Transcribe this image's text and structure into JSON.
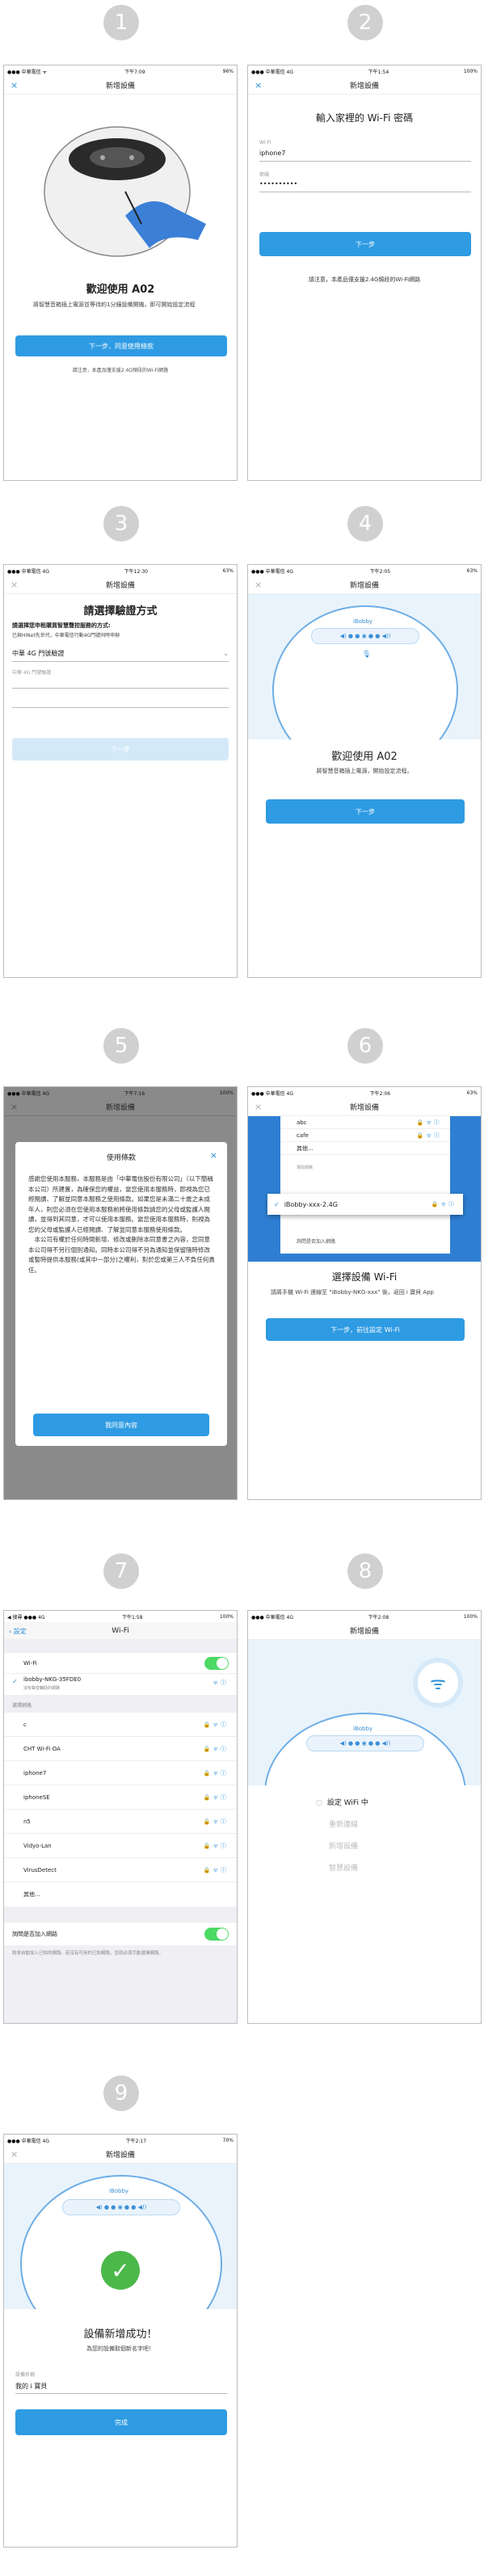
{
  "steps": [
    "1",
    "2",
    "3",
    "4",
    "5",
    "6",
    "7",
    "8",
    "9"
  ],
  "common": {
    "title": "新增設備",
    "close": "×",
    "battery": "100%",
    "carrier": "中華電信"
  },
  "p1": {
    "status": {
      "carrier": "●●● 中華電信 ᯤ",
      "time": "下午7:09",
      "battery": "96%"
    },
    "heading": "歡迎使用 A02",
    "desc": "將智慧音箱插上電源並等待約1分鐘設備開機，即可開始設定流程",
    "btn": "下一步，同意使用條款",
    "note": "請注意，本產品僅支援2.4G頻段的Wi-Fi網路"
  },
  "p2": {
    "status": {
      "carrier": "●●● 中華電信 4G",
      "time": "下午1:54",
      "battery": "100%"
    },
    "heading": "輸入家裡的 Wi-Fi 密碼",
    "wifi_label": "Wi-Fi",
    "wifi_value": "iphone7",
    "pwd_label": "密碼",
    "pwd_value": "••••••••••",
    "btn": "下一步",
    "note": "請注意，本產品僅支援2.4G頻段的Wi-Fi網路"
  },
  "p3": {
    "status": {
      "carrier": "●●● 中華電信 4G",
      "time": "下午12:30",
      "battery": "63%"
    },
    "heading": "請選擇驗證方式",
    "desc1": "請選擇您申租購買智慧聲控服務的方式:",
    "desc2": "已與HiNet先世代，中華電信行動4G門號同時申辦",
    "select": "中華 4G 門號驗證",
    "field_label": "中華 4G 門號驗證",
    "btn": "下一步"
  },
  "p4": {
    "status": {
      "carrier": "●●● 中華電信 4G",
      "time": "下午2:05",
      "battery": "63%"
    },
    "brand": "iBobby",
    "heading": "歡迎使用 A02",
    "desc": "將智慧音箱插上電源，開始設定流程。",
    "btn": "下一步"
  },
  "p5": {
    "status": {
      "carrier": "●●● 中華電信 4G",
      "time": "下午7:16",
      "battery": "100%"
    },
    "modal_title": "使用條款",
    "body": "感謝您使用本服務，本服務是由「中華電信股份有限公司」（以下簡稱本公司）所建置，為確保您的權益，當您使用本服務時，即視為您已經閱讀、了解並同意本服務之使用條款。如果您是未滿二十歲之未成年人，則您必須在您使用本服務前將使用條款請您的父母或監護人閱讀，並得到其同意，才可以使用本服務。當您使用本服務時，則視為您的父母或監護人已經閱讀、了解並同意本服務使用條款。\n　本公司有權於任何時間新增、修改或刪除本同意書之內容，您同意本公司得不另行個別通知。同時本公司得不另為通知並保留隨時修改或暫時提供本服務(或其中一部分)之權利，對於您或第三人不負任何責任。",
    "btn": "我同意內容"
  },
  "p6": {
    "status": {
      "carrier": "●●● 中華電信 4G",
      "time": "下午2:06",
      "battery": "63%"
    },
    "list": [
      "abc",
      "cafe",
      "其他..."
    ],
    "section": "選取網路",
    "selected": "iBobby-xxx-2.4G",
    "ask": "詢問是否加入網路",
    "heading": "選擇設備 Wi-Fi",
    "desc": "請將手機 Wi-Fi 連線至 \"iBobby-NKG-xxx\" 後，返回 i 寶貝 App",
    "btn": "下一步，前往設定 Wi-Fi"
  },
  "p7": {
    "status": {
      "carrier": "◀ 搜尋 ●●● 4G",
      "time": "下午1:58",
      "battery": "100%"
    },
    "back": "設定",
    "title": "Wi-Fi",
    "wifi": "Wi-Fi",
    "connected": "ibobby-NKG-35FDE0",
    "connected_sub": "沒有聲音輔助的網路",
    "section": "選擇網路",
    "networks": [
      "c",
      "CHT Wi-Fi OA",
      "iphone7",
      "iphoneSE",
      "n5",
      "Vidyo-Lan",
      "VirusDetect",
      "其他..."
    ],
    "ask": "詢問是否加入網路",
    "ask_desc": "將會自動加入已知的網路。若沒有可用的已知網路，您就必須手動選擇網路。"
  },
  "p8": {
    "status": {
      "carrier": "●●● 中華電信 4G",
      "time": "下午2:08",
      "battery": "100%"
    },
    "progress": [
      "設定 WiFi 中",
      "重新連線",
      "新增設備",
      "智慧設備"
    ]
  },
  "p9": {
    "status": {
      "carrier": "●●● 中華電信 4G",
      "time": "下午2:17",
      "battery": "70%"
    },
    "heading": "設備新增成功！",
    "desc": "為您的設備取個新名字吧！",
    "name_label": "設備名稱",
    "name_value": "我的 i 寶貝",
    "btn": "完成"
  },
  "colors": {
    "accent": "#2e9be3",
    "hero": "#e9f3fb"
  }
}
